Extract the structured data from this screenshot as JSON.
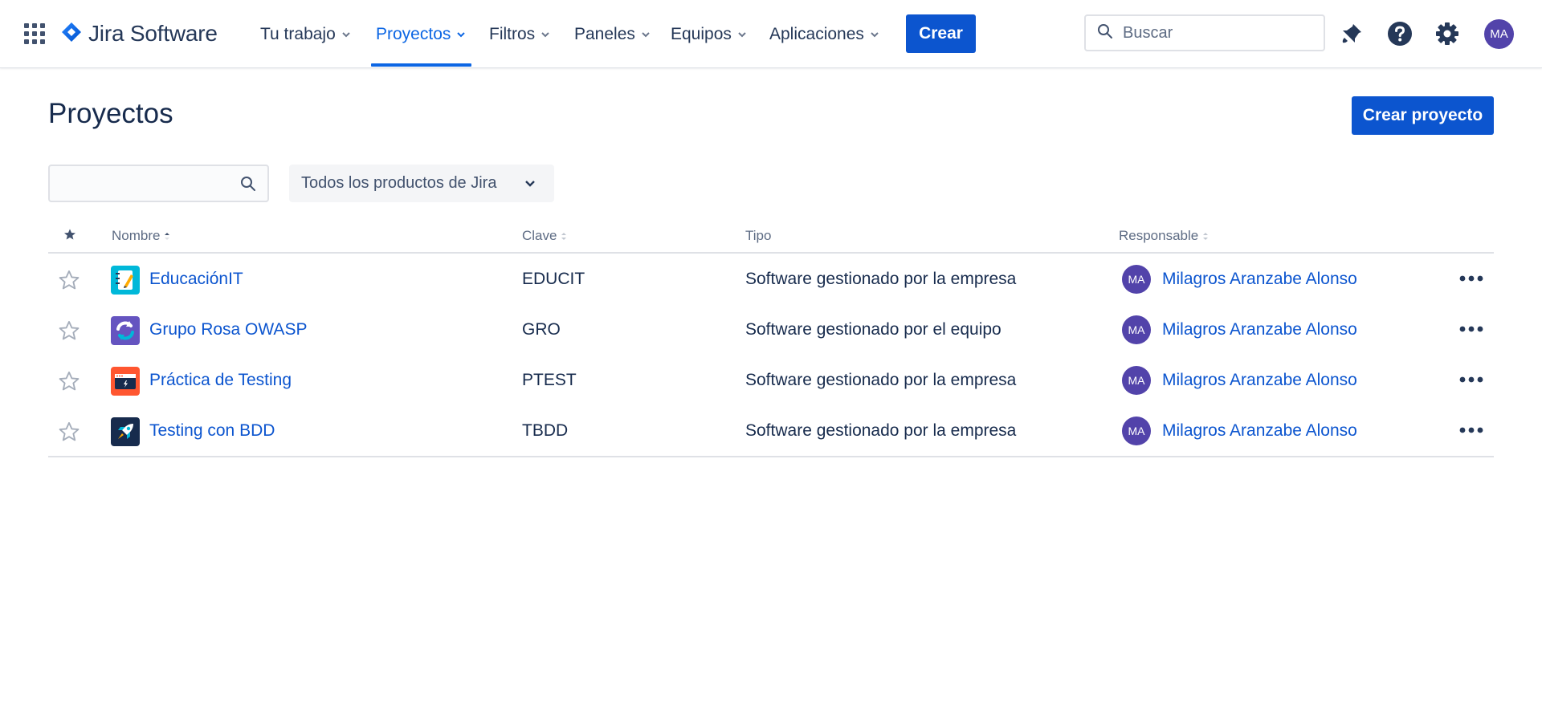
{
  "nav": {
    "brand": "Jira Software",
    "items": [
      {
        "label": "Tu trabajo"
      },
      {
        "label": "Proyectos"
      },
      {
        "label": "Filtros"
      },
      {
        "label": "Paneles"
      },
      {
        "label": "Equipos"
      },
      {
        "label": "Aplicaciones"
      }
    ],
    "active_item": "Proyectos",
    "create_label": "Crear",
    "search_placeholder": "Buscar",
    "avatar_initials": "MA",
    "icons": [
      "app-switcher-icon",
      "notifications-icon",
      "help-icon",
      "settings-icon"
    ]
  },
  "page": {
    "title": "Proyectos",
    "create_project_label": "Crear proyecto"
  },
  "filters": {
    "search_value": "",
    "product_select": "Todos los productos de Jira"
  },
  "table": {
    "columns": {
      "name": "Nombre",
      "key": "Clave",
      "type": "Tipo",
      "lead": "Responsable"
    },
    "sorted_by": "Nombre",
    "rows": [
      {
        "name": "EducaciónIT",
        "key": "EDUCIT",
        "type": "Software gestionado por la empresa",
        "lead": "Milagros Aranzabe Alonso",
        "lead_initials": "MA",
        "icon": "notebook-icon",
        "starred": false
      },
      {
        "name": "Grupo Rosa OWASP",
        "key": "GRO",
        "type": "Software gestionado por el equipo",
        "lead": "Milagros Aranzabe Alonso",
        "lead_initials": "MA",
        "icon": "refresh-cycle-icon",
        "starred": false
      },
      {
        "name": "Práctica de Testing",
        "key": "PTEST",
        "type": "Software gestionado por la empresa",
        "lead": "Milagros Aranzabe Alonso",
        "lead_initials": "MA",
        "icon": "terminal-window-icon",
        "starred": false
      },
      {
        "name": "Testing con BDD",
        "key": "TBDD",
        "type": "Software gestionado por la empresa",
        "lead": "Milagros Aranzabe Alonso",
        "lead_initials": "MA",
        "icon": "rocket-icon",
        "starred": false
      }
    ]
  },
  "colors": {
    "primary": "#0c55cf",
    "active_nav": "#0c66e4",
    "avatar": "#5243aa",
    "text": "#172b4d"
  }
}
